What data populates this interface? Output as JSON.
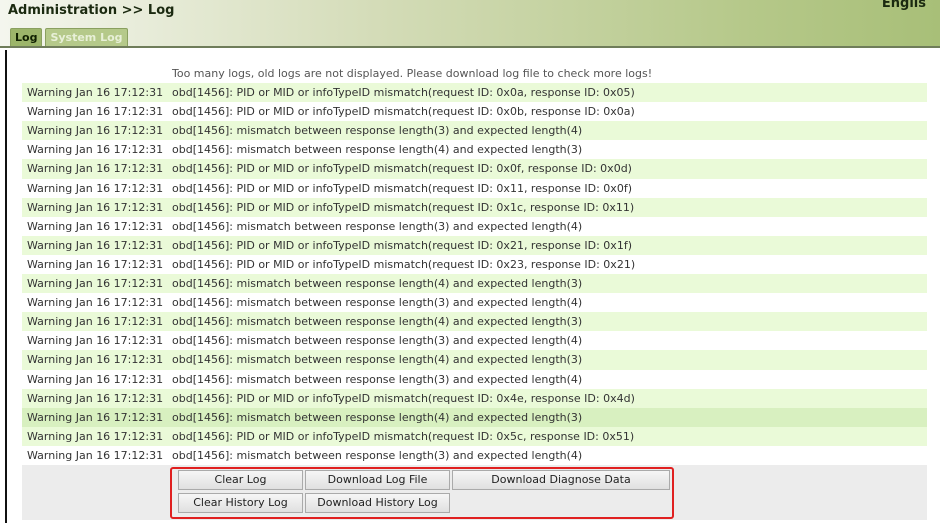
{
  "header": {
    "title": "Administration >> Log",
    "language": "Englis"
  },
  "tabs": [
    {
      "label": "Log",
      "active": true
    },
    {
      "label": "System Log",
      "active": false
    }
  ],
  "notice": "Too many logs, old logs are not displayed. Please download log file to check more logs!",
  "logs": [
    {
      "level": "Warning",
      "time": "Jan 16 17:12:31",
      "msg": "obd[1456]: PID or MID or infoTypeID mismatch(request ID: 0x0a, response ID: 0x05)"
    },
    {
      "level": "Warning",
      "time": "Jan 16 17:12:31",
      "msg": "obd[1456]: PID or MID or infoTypeID mismatch(request ID: 0x0b, response ID: 0x0a)"
    },
    {
      "level": "Warning",
      "time": "Jan 16 17:12:31",
      "msg": "obd[1456]: mismatch between response length(3) and expected length(4)"
    },
    {
      "level": "Warning",
      "time": "Jan 16 17:12:31",
      "msg": "obd[1456]: mismatch between response length(4) and expected length(3)"
    },
    {
      "level": "Warning",
      "time": "Jan 16 17:12:31",
      "msg": "obd[1456]: PID or MID or infoTypeID mismatch(request ID: 0x0f, response ID: 0x0d)"
    },
    {
      "level": "Warning",
      "time": "Jan 16 17:12:31",
      "msg": "obd[1456]: PID or MID or infoTypeID mismatch(request ID: 0x11, response ID: 0x0f)"
    },
    {
      "level": "Warning",
      "time": "Jan 16 17:12:31",
      "msg": "obd[1456]: PID or MID or infoTypeID mismatch(request ID: 0x1c, response ID: 0x11)"
    },
    {
      "level": "Warning",
      "time": "Jan 16 17:12:31",
      "msg": "obd[1456]: mismatch between response length(3) and expected length(4)"
    },
    {
      "level": "Warning",
      "time": "Jan 16 17:12:31",
      "msg": "obd[1456]: PID or MID or infoTypeID mismatch(request ID: 0x21, response ID: 0x1f)"
    },
    {
      "level": "Warning",
      "time": "Jan 16 17:12:31",
      "msg": "obd[1456]: PID or MID or infoTypeID mismatch(request ID: 0x23, response ID: 0x21)"
    },
    {
      "level": "Warning",
      "time": "Jan 16 17:12:31",
      "msg": "obd[1456]: mismatch between response length(4) and expected length(3)"
    },
    {
      "level": "Warning",
      "time": "Jan 16 17:12:31",
      "msg": "obd[1456]: mismatch between response length(3) and expected length(4)"
    },
    {
      "level": "Warning",
      "time": "Jan 16 17:12:31",
      "msg": "obd[1456]: mismatch between response length(4) and expected length(3)"
    },
    {
      "level": "Warning",
      "time": "Jan 16 17:12:31",
      "msg": "obd[1456]: mismatch between response length(3) and expected length(4)"
    },
    {
      "level": "Warning",
      "time": "Jan 16 17:12:31",
      "msg": "obd[1456]: mismatch between response length(4) and expected length(3)"
    },
    {
      "level": "Warning",
      "time": "Jan 16 17:12:31",
      "msg": "obd[1456]: mismatch between response length(3) and expected length(4)"
    },
    {
      "level": "Warning",
      "time": "Jan 16 17:12:31",
      "msg": "obd[1456]: PID or MID or infoTypeID mismatch(request ID: 0x4e, response ID: 0x4d)"
    },
    {
      "level": "Warning",
      "time": "Jan 16 17:12:31",
      "msg": "obd[1456]: mismatch between response length(4) and expected length(3)"
    },
    {
      "level": "Warning",
      "time": "Jan 16 17:12:31",
      "msg": "obd[1456]: PID or MID or infoTypeID mismatch(request ID: 0x5c, response ID: 0x51)"
    },
    {
      "level": "Warning",
      "time": "Jan 16 17:12:31",
      "msg": "obd[1456]: mismatch between response length(3) and expected length(4)"
    }
  ],
  "buttons": {
    "clear_log": "Clear Log",
    "download_log_file": "Download Log File",
    "download_diagnose": "Download Diagnose Data",
    "clear_history": "Clear History Log",
    "download_history": "Download History Log"
  }
}
